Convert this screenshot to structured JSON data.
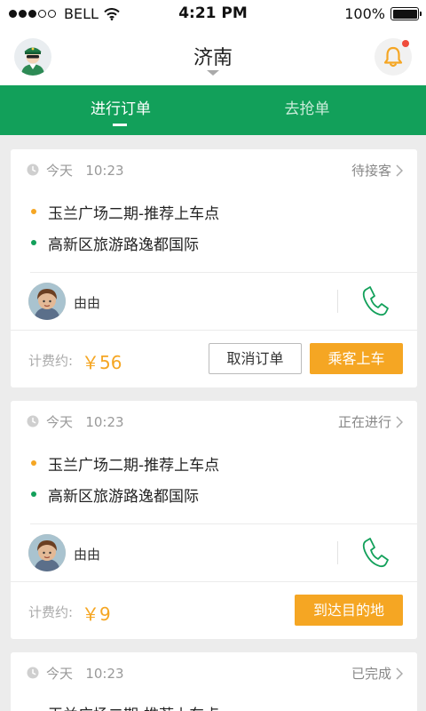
{
  "status_bar": {
    "carrier": "BELL",
    "time": "4:21 PM",
    "battery": "100%",
    "signal_bars": 5,
    "signal_filled": 3
  },
  "header": {
    "city": "济南",
    "avatar_icon": "driver-avatar-icon",
    "notification_icon": "bell-icon",
    "has_notification": true
  },
  "tabs": [
    {
      "label": "进行订单",
      "active": true
    },
    {
      "label": "去抢单",
      "active": false
    }
  ],
  "orders": [
    {
      "time_day": "今天",
      "time_clock": "10:23",
      "status": "待接客",
      "pickup": "玉兰广场二期-推荐上车点",
      "dropoff": "高新区旅游路逸都国际",
      "passenger_name": "由由",
      "fare_label": "计费约:",
      "fare_amount": "￥56",
      "buttons": [
        "取消订单",
        "乘客上车"
      ]
    },
    {
      "time_day": "今天",
      "time_clock": "10:23",
      "status": "正在进行",
      "pickup": "玉兰广场二期-推荐上车点",
      "dropoff": "高新区旅游路逸都国际",
      "passenger_name": "由由",
      "fare_label": "计费约:",
      "fare_amount": "￥9",
      "buttons": [
        "到达目的地"
      ]
    },
    {
      "time_day": "今天",
      "time_clock": "10:23",
      "status": "已完成",
      "pickup": "玉兰广场二期-推荐上车点"
    }
  ],
  "colors": {
    "brand_green": "#12a05a",
    "accent_orange": "#f5a623",
    "pickup_dot": "#f5a623",
    "dropoff_dot": "#12a05a",
    "badge_red": "#ef4c3b"
  }
}
